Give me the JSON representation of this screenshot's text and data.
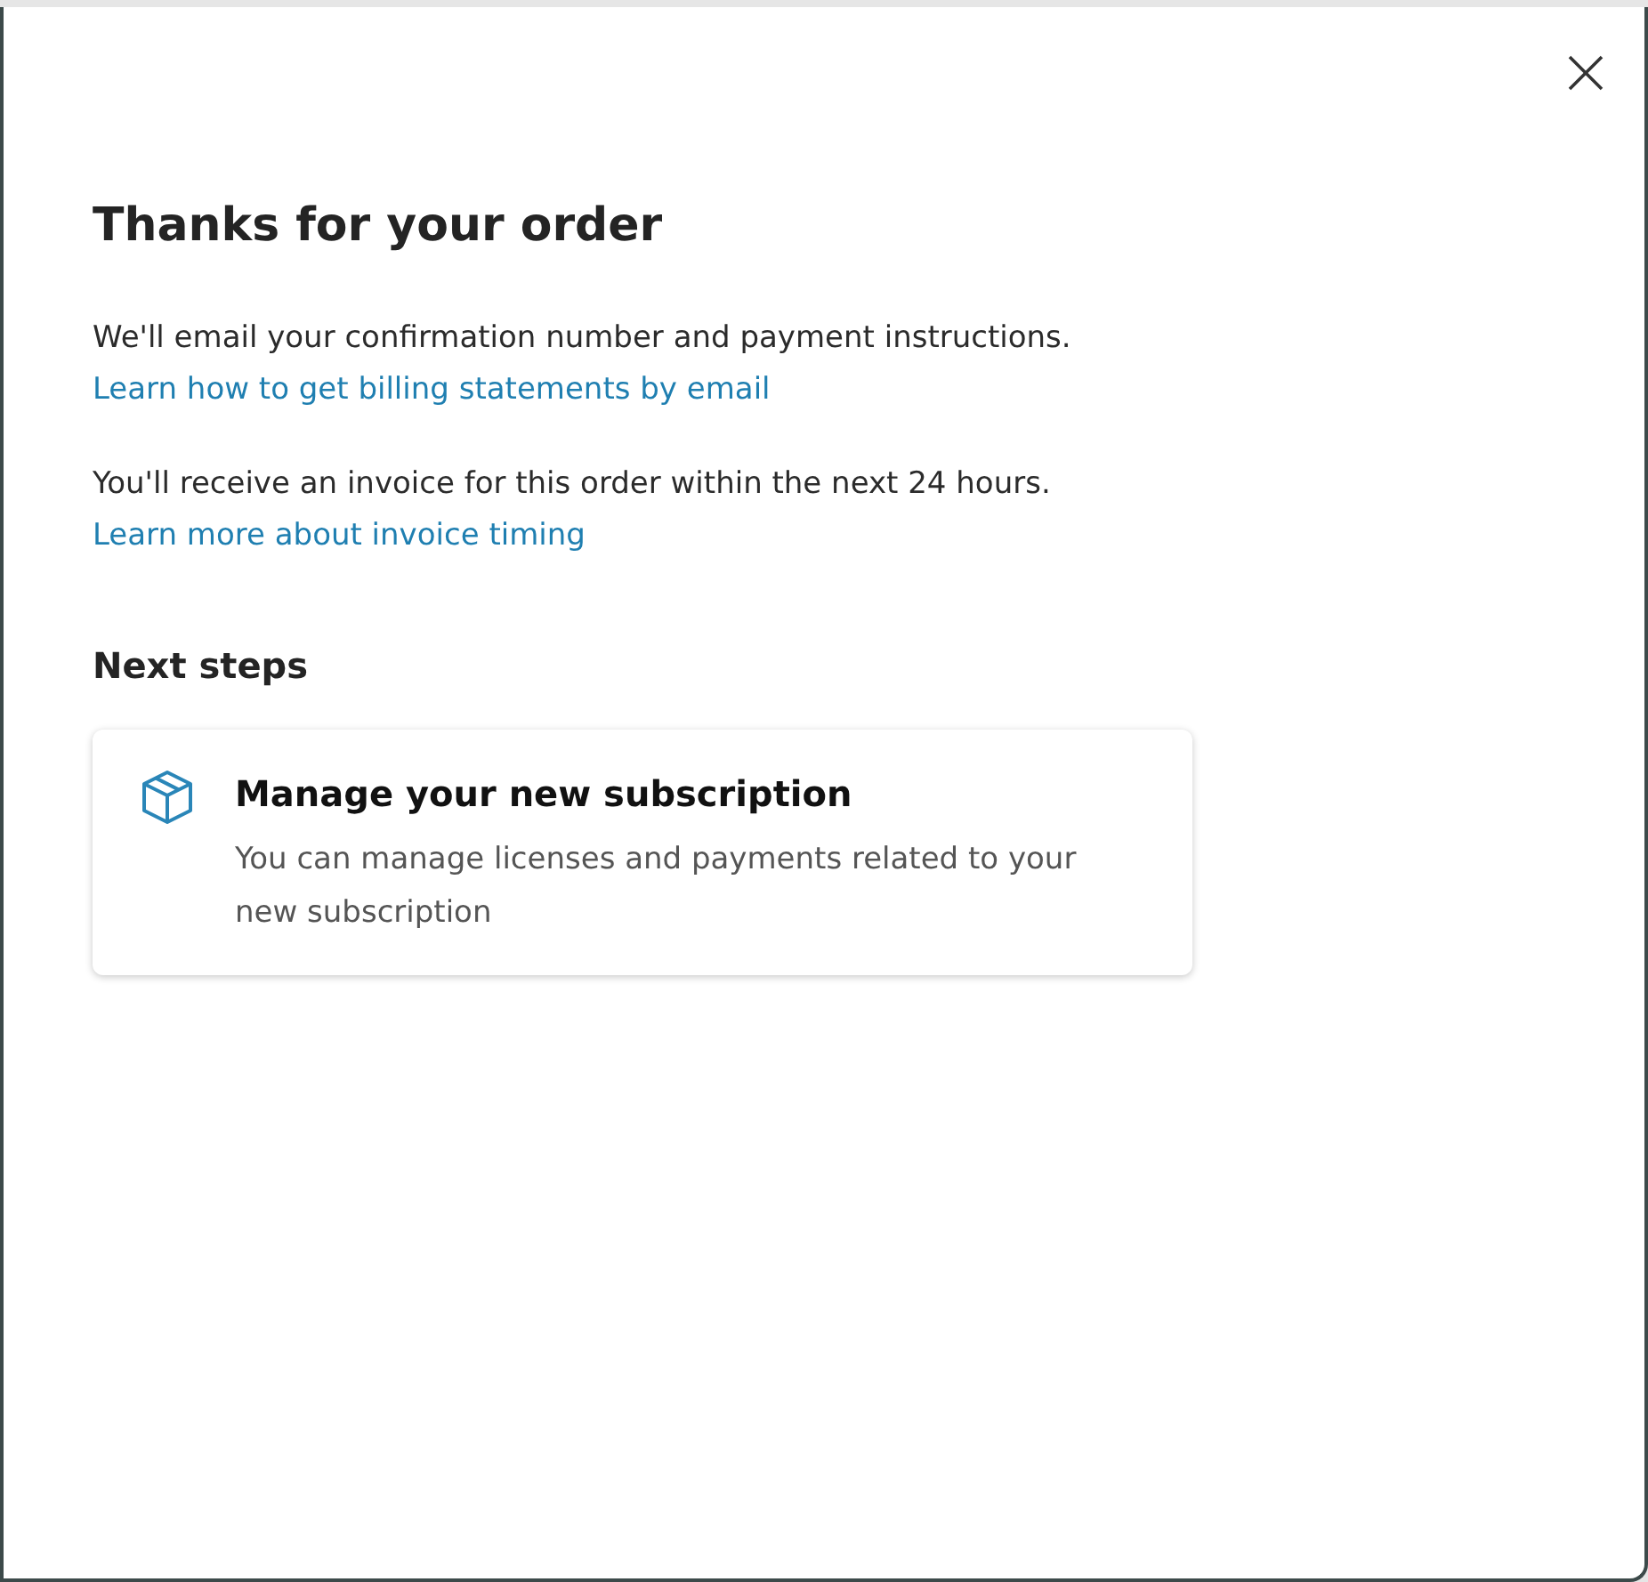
{
  "dialog": {
    "title": "Thanks for your order",
    "paragraphs": [
      {
        "text": "We'll email your confirmation number and payment instructions.",
        "link": "Learn how to get billing statements by email"
      },
      {
        "text": "You'll receive an invoice for this order within the next 24 hours.",
        "link": "Learn more about invoice timing"
      }
    ],
    "section_title": "Next steps",
    "cards": [
      {
        "title": "Manage your new subscription",
        "description": "You can manage licenses and payments related to your new subscription"
      }
    ]
  }
}
